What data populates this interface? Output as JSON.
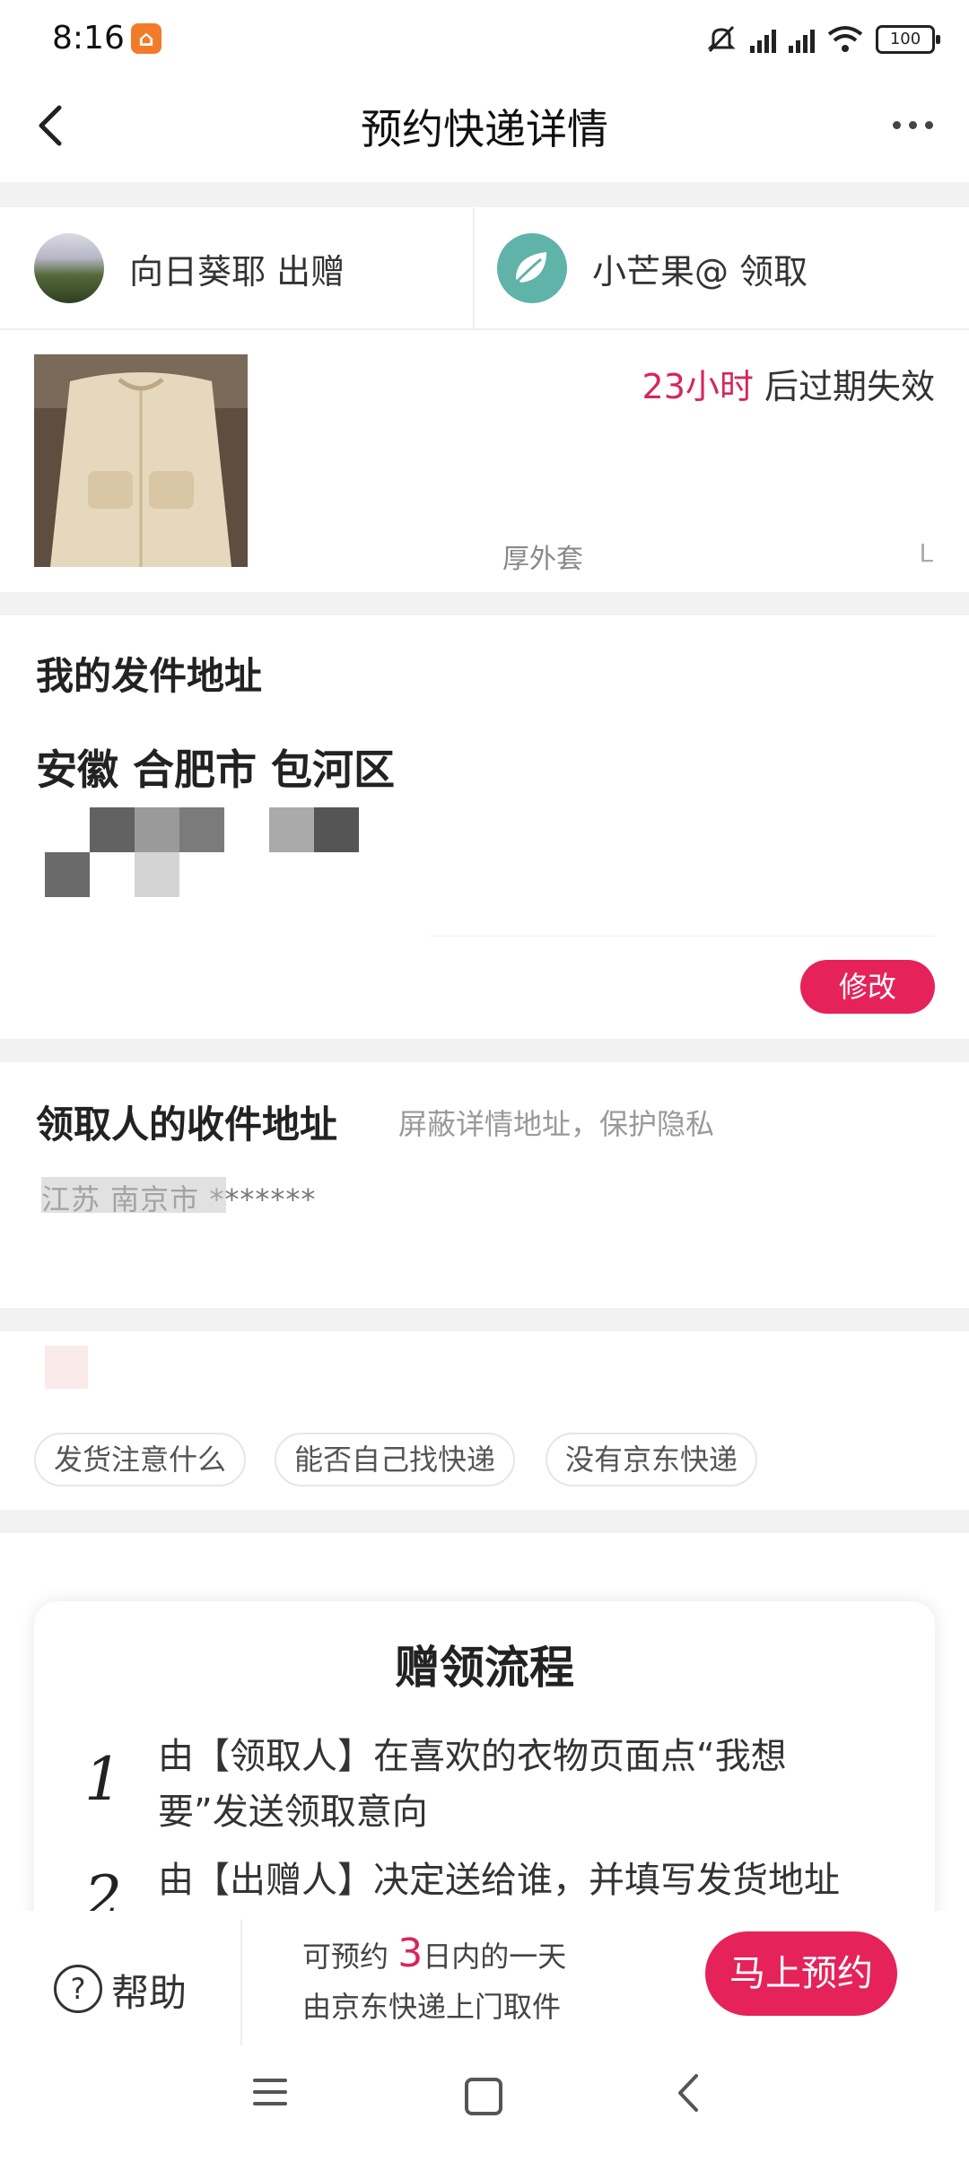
{
  "status_bar": {
    "time": "8:16",
    "battery": "100"
  },
  "header": {
    "title": "预约快递详情"
  },
  "users": {
    "giver": {
      "name": "向日葵耶 出赠"
    },
    "receiver": {
      "name": "小芒果@ 领取"
    }
  },
  "product": {
    "expire_num": "23小时",
    "expire_suffix": " 后过期失效",
    "name": "厚外套",
    "size": "L"
  },
  "sender_address": {
    "title": "我的发件地址",
    "region": "安徽 合肥市 包河区",
    "edit_label": "修改"
  },
  "receiver_address": {
    "title": "领取人的收件地址",
    "note": "屏蔽详情地址，保护隐私",
    "address": "江苏 南京市 *******"
  },
  "faq_chips": [
    "发货注意什么",
    "能否自己找快递",
    "没有京东快递"
  ],
  "process": {
    "title": "赠领流程",
    "steps": [
      {
        "num": "1",
        "text": "由【领取人】在喜欢的衣物页面点“我想要”发送领取意向"
      },
      {
        "num": "2",
        "text": "由【出赠人】决定送给谁，并填写发货地址"
      }
    ]
  },
  "bottom_bar": {
    "help_label": "帮助",
    "info_prefix": "可预约 ",
    "info_days": "3",
    "info_suffix": "日内的一天",
    "info_line2": "由京东快递上门取件",
    "book_label": "马上预约"
  },
  "colors": {
    "accent": "#e6225a",
    "highlight": "#d8265a"
  }
}
